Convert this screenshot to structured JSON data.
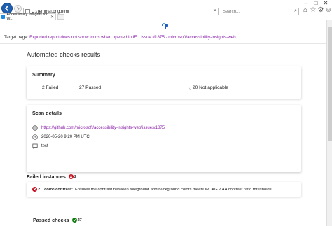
{
  "browser": {
    "address": "C:\\Temp\\ai.orig.html",
    "search_placeholder": "Search...",
    "tab_title": "Accessibility Insights for W...",
    "icons": [
      "back-icon",
      "forward-icon",
      "home-icon",
      "star-icon",
      "settings-icon",
      "smiley-icon"
    ]
  },
  "page": {
    "target_label": "Target page:",
    "target_link": "Exported report does not show icons when opened in IE · Issue #1875 · microsoft/accessibility-insights-web",
    "heading": "Automated checks results"
  },
  "summary": {
    "title": "Summary",
    "failed": "2 Failed",
    "passed": "27 Passed",
    "not_applicable": "20 Not applicable"
  },
  "scan_details": {
    "title": "Scan details",
    "url": "https://github.com/microsoft/accessibility-insights-web/issues/1875",
    "datetime": "2020-05-20 9:20 PM UTC",
    "comment": "test"
  },
  "failed_instances": {
    "title": "Failed instances",
    "count": "2",
    "rules": [
      {
        "count": "2",
        "id": "color-contrast:",
        "description": "Ensures the contrast between foreground and background colors meets WCAG 2 AA contrast ratio thresholds"
      }
    ]
  },
  "passed_checks": {
    "title": "Passed checks",
    "count": "27"
  },
  "colors": {
    "link": "#8a21a8",
    "fail": "#c50f1f",
    "pass": "#107c10",
    "browser_blue": "#1f5fae"
  }
}
